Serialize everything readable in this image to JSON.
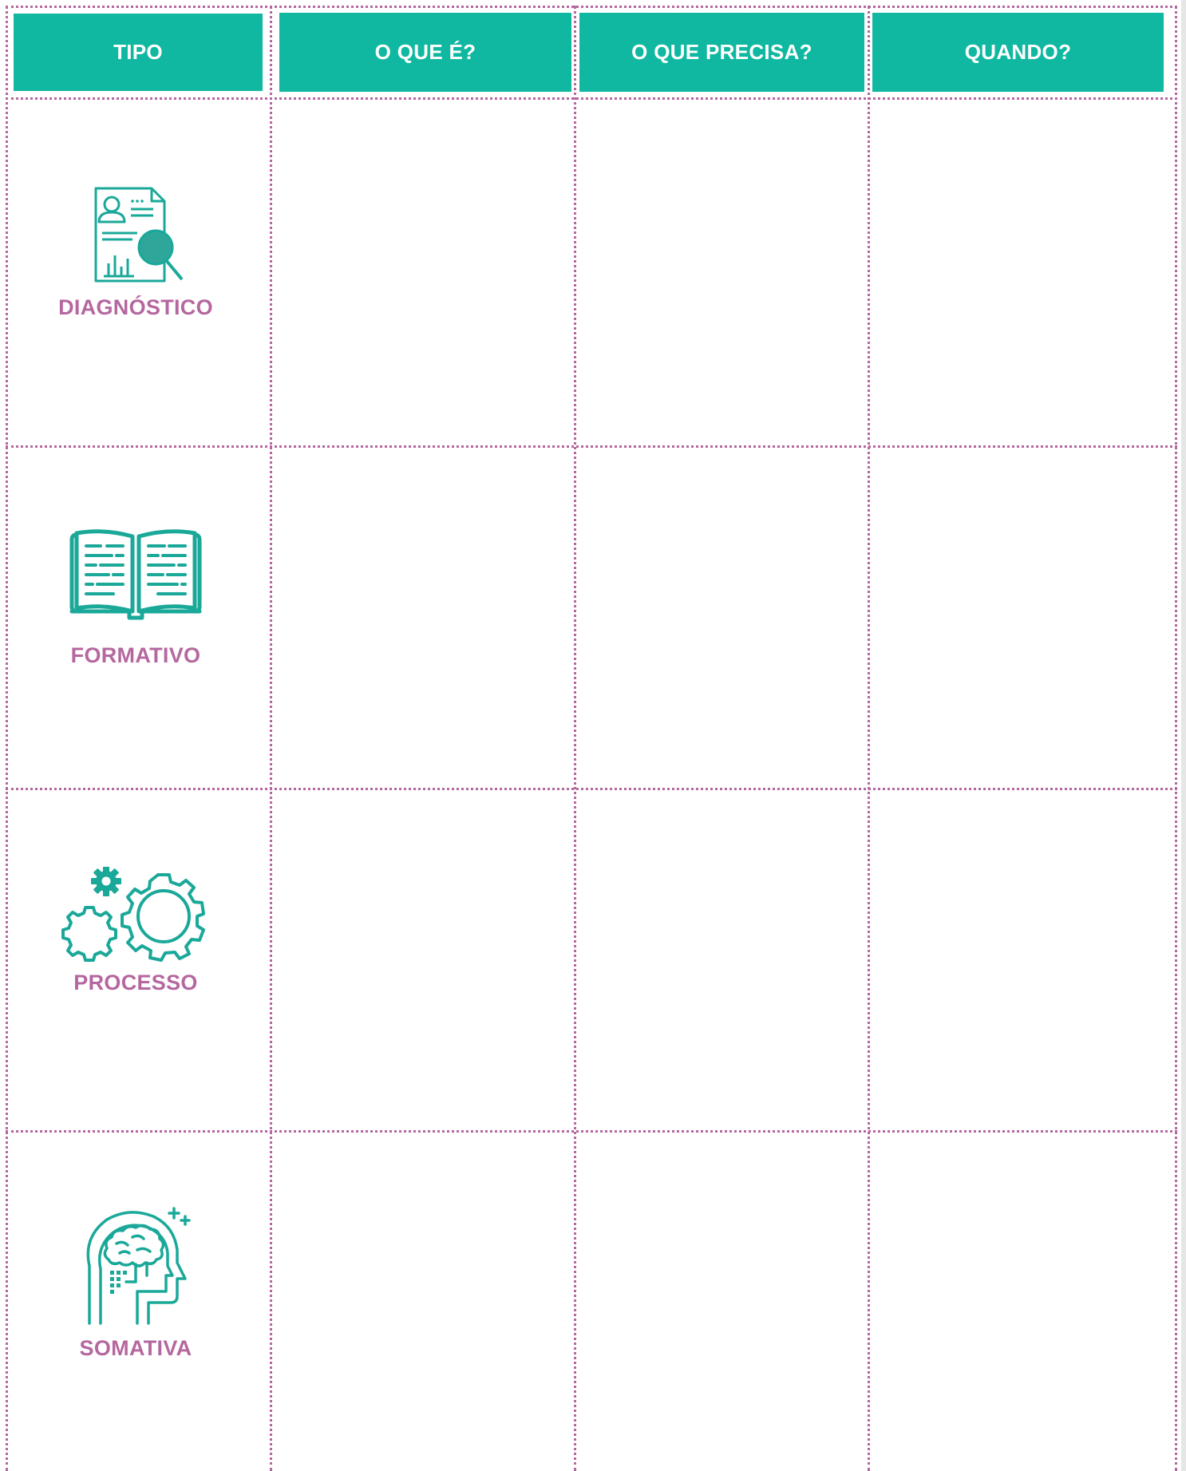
{
  "header": {
    "col_type": "TIPO",
    "col_what": "O QUE É?",
    "col_needs": "O QUE PRECISA?",
    "col_when": "QUANDO?"
  },
  "rows": [
    {
      "label": "DIAGNÓSTICO",
      "icon": "document-search-icon"
    },
    {
      "label": "FORMATIVO",
      "icon": "open-book-icon"
    },
    {
      "label": "PROCESSO",
      "icon": "gears-icon"
    },
    {
      "label": "SOMATIVA",
      "icon": "brain-head-icon"
    }
  ],
  "colors": {
    "header_bg": "#10b8a1",
    "accent_pink": "#b5679f",
    "icon_teal": "#1aa899"
  }
}
